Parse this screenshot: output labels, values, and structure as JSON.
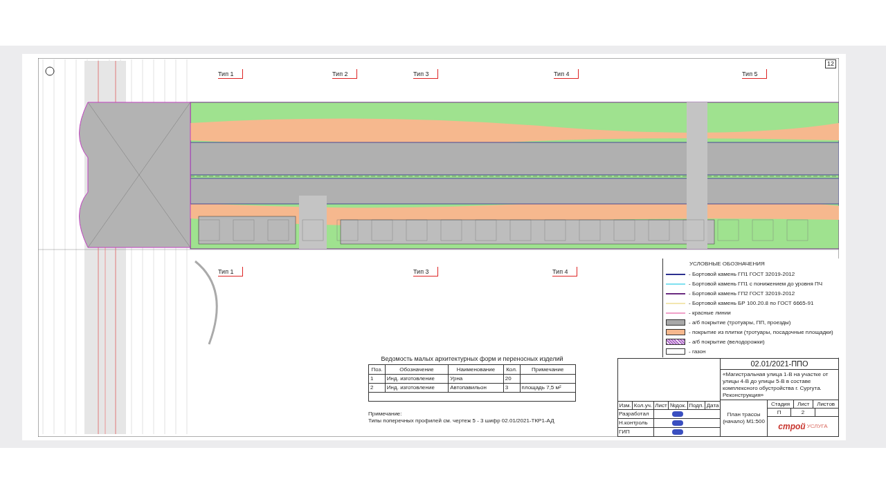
{
  "sheet": {
    "page_number": "12",
    "markers_top": [
      "Тип 1",
      "Тип 2",
      "Тип 3",
      "Тип 4",
      "Тип 5"
    ],
    "markers_bottom": [
      "Тип 1",
      "Тип 3",
      "Тип 4"
    ],
    "table": {
      "title": "Ведомость малых архитектурных форм и переносных изделий",
      "columns": [
        "Поз.",
        "Обозначение",
        "Наименование",
        "Кол.",
        "Примечание"
      ],
      "rows": [
        [
          "1",
          "Инд. изготовление",
          "Урна",
          "20",
          ""
        ],
        [
          "2",
          "Инд. изготовление",
          "Автопавильон",
          "3",
          "площадь 7,5 м²"
        ]
      ]
    },
    "notes": {
      "title": "Примечание:",
      "text": "Типы поперечных профилей см. чертеж 5 - 3 шифр 02.01/2021-ТКР1-АД"
    },
    "legend": {
      "title": "УСЛОВНЫЕ ОБОЗНАЧЕНИЯ",
      "items": [
        {
          "kind": "line",
          "color": "#2b2f8f",
          "label": "- Бортовой камень ГП1 ГОСТ 32019-2012"
        },
        {
          "kind": "line",
          "color": "#7fe0f0",
          "label": "- Бортовой камень ГП1 с понижением до уровня ПЧ"
        },
        {
          "kind": "line",
          "color": "#6a2a80",
          "label": "- Бортовой камень ГП2 ГОСТ 32019-2012"
        },
        {
          "kind": "line",
          "color": "#f3e6b0",
          "label": "- Бортовой камень БР 100.20.8 по ГОСТ 6665-91"
        },
        {
          "kind": "line",
          "color": "#f0a0c8",
          "label": "- красные линии"
        },
        {
          "kind": "fill",
          "color": "#a8a8a8",
          "label": "- а/б покрытие (тротуары, ПП, проезды)"
        },
        {
          "kind": "fill",
          "color": "#f6b88e",
          "label": "- покрытие из плитки (тротуары, посадочные площадки)"
        },
        {
          "kind": "hatch",
          "color": "#b070c8",
          "label": "- а/б покрытие (велодорожки)"
        },
        {
          "kind": "fill",
          "color": "#ffffff",
          "label": "- газон"
        }
      ]
    },
    "title_block": {
      "code": "02.01/2021-ППО",
      "description": "«Магистральная улица 1-В на участке от улицы 4-В до улицы 5-В в составе комплексного обустройства г. Сургута. Реконструкция»",
      "sheet_title": "План трассы (начало) М1:500",
      "stage_headers": [
        "Стадия",
        "Лист",
        "Листов"
      ],
      "stage_values": [
        "П",
        "2"
      ],
      "signature_headers": [
        "Изм.",
        "Кол.уч.",
        "Лист",
        "№док.",
        "Подп.",
        "Дата"
      ],
      "roles": [
        "Разработал",
        "Н.контроль",
        "ГИП"
      ],
      "logo": [
        "строй",
        "УСЛУГА"
      ]
    }
  }
}
